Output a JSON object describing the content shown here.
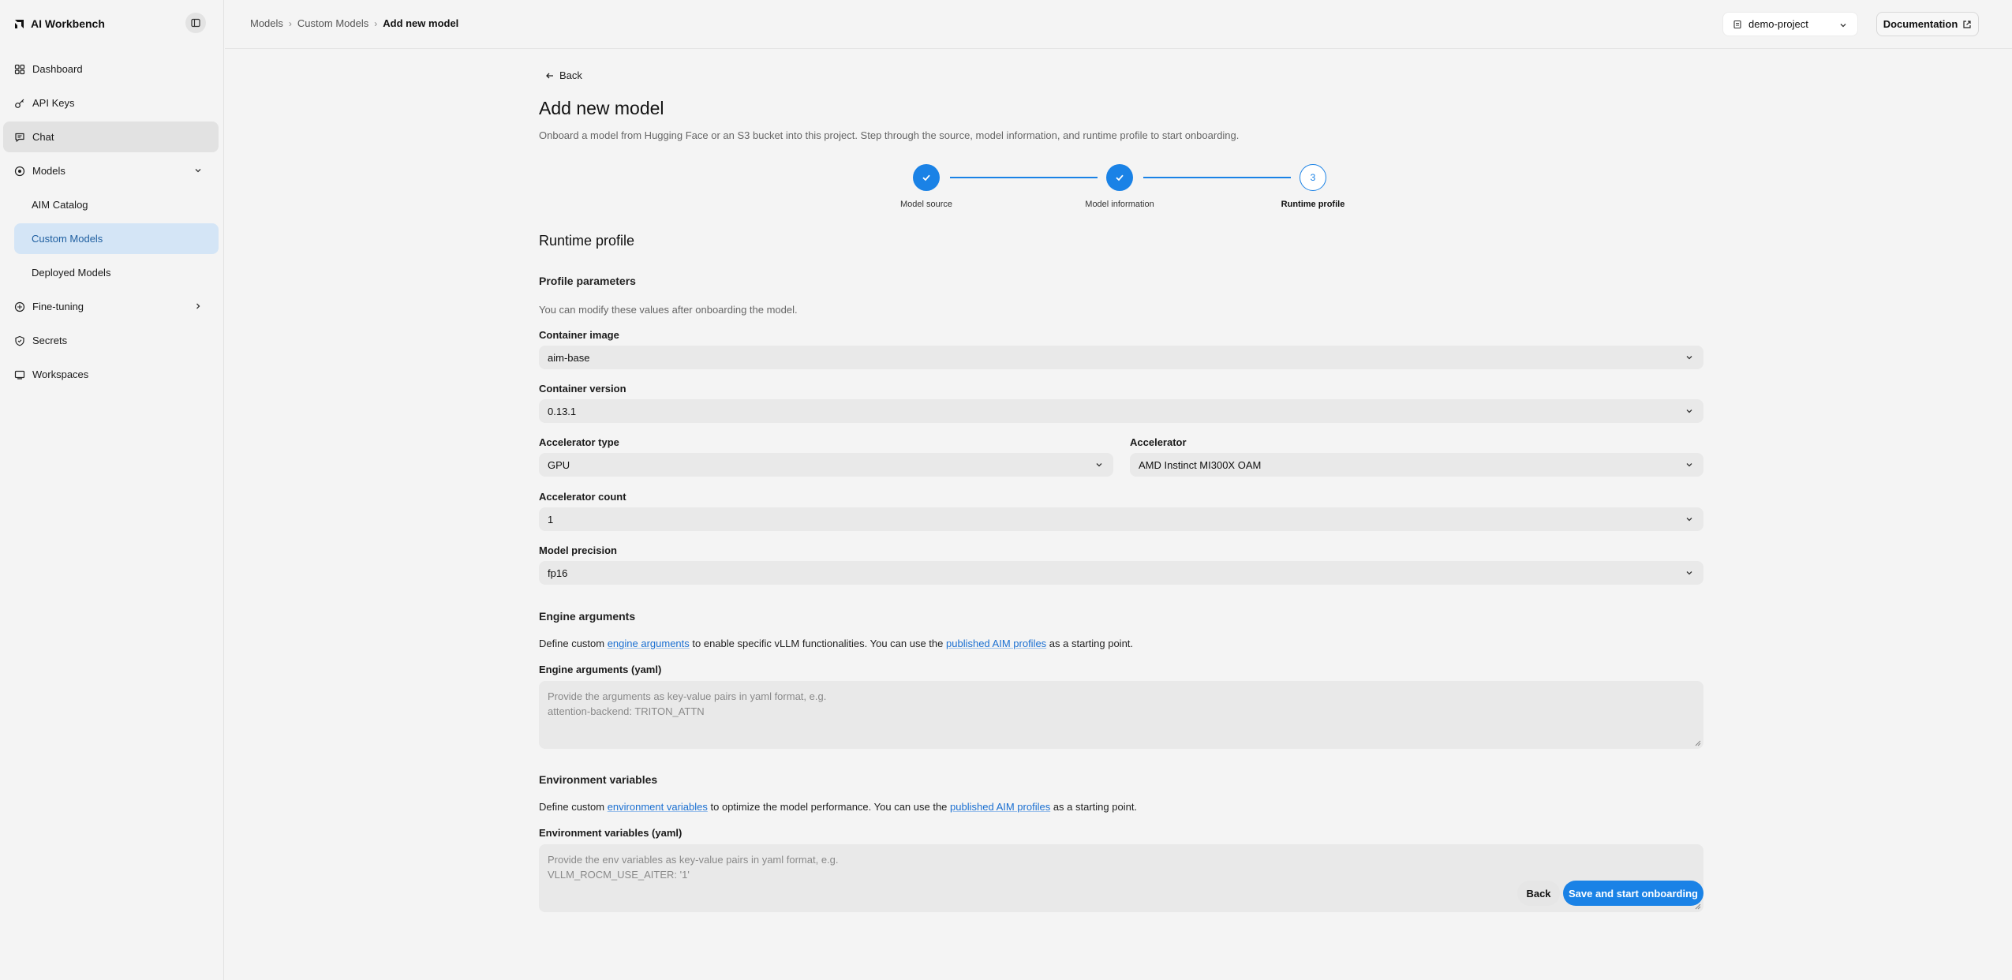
{
  "app": {
    "title": "AI Workbench"
  },
  "sidebar": {
    "items": [
      {
        "label": "Dashboard",
        "icon": "dashboard-icon"
      },
      {
        "label": "API Keys",
        "icon": "key-icon"
      },
      {
        "label": "Chat",
        "icon": "chat-icon"
      },
      {
        "label": "Models",
        "icon": "models-icon"
      },
      {
        "label": "AIM Catalog"
      },
      {
        "label": "Custom Models"
      },
      {
        "label": "Deployed Models"
      },
      {
        "label": "Fine-tuning",
        "icon": "fine-tuning-icon"
      },
      {
        "label": "Secrets",
        "icon": "shield-icon"
      },
      {
        "label": "Workspaces",
        "icon": "workspace-icon"
      }
    ]
  },
  "header": {
    "breadcrumbs": [
      "Models",
      "Custom Models",
      "Add new model"
    ],
    "project": "demo-project",
    "documentation": "Documentation"
  },
  "page": {
    "back": "Back",
    "title": "Add new model",
    "description": "Onboard a model from Hugging Face or an S3 bucket into this project. Step through the source, model information, and runtime profile to start onboarding."
  },
  "stepper": {
    "steps": [
      {
        "label": "Model source",
        "state": "done"
      },
      {
        "label": "Model information",
        "state": "done"
      },
      {
        "label": "Runtime profile",
        "state": "current",
        "number": "3"
      }
    ]
  },
  "form": {
    "section_title": "Runtime profile",
    "profile_title": "Profile parameters",
    "profile_hint": "You can modify these values after onboarding the model.",
    "container_image": {
      "label": "Container image",
      "value": "aim-base"
    },
    "container_version": {
      "label": "Container version",
      "value": "0.13.1"
    },
    "accelerator_type": {
      "label": "Accelerator type",
      "value": "GPU"
    },
    "accelerator": {
      "label": "Accelerator",
      "value": "AMD Instinct MI300X OAM"
    },
    "accelerator_count": {
      "label": "Accelerator count",
      "value": "1"
    },
    "model_precision": {
      "label": "Model precision",
      "value": "fp16"
    },
    "engine": {
      "title": "Engine arguments",
      "text_pre": "Define custom ",
      "link1": "engine arguments",
      "text_mid": " to enable specific vLLM functionalities. You can use the ",
      "link2": "published AIM profiles",
      "text_post": " as a starting point.",
      "field_label": "Engine arguments (yaml)",
      "placeholder_line1": "Provide the arguments as key-value pairs in yaml format, e.g.",
      "placeholder_line2": "attention-backend: TRITON_ATTN"
    },
    "env": {
      "title": "Environment variables",
      "text_pre": "Define custom ",
      "link1": "environment variables",
      "text_mid": " to optimize the model performance. You can use the ",
      "link2": "published AIM profiles",
      "text_post": " as a starting point.",
      "field_label": "Environment variables (yaml)",
      "placeholder_line1": "Provide the env variables as key-value pairs in yaml format, e.g.",
      "placeholder_line2": "VLLM_ROCM_USE_AITER: '1'"
    }
  },
  "actions": {
    "back": "Back",
    "submit": "Save and start onboarding"
  },
  "colors": {
    "accent": "#1a82e6",
    "link": "#1a6fd1",
    "selected_bg": "#d4e5f6"
  }
}
